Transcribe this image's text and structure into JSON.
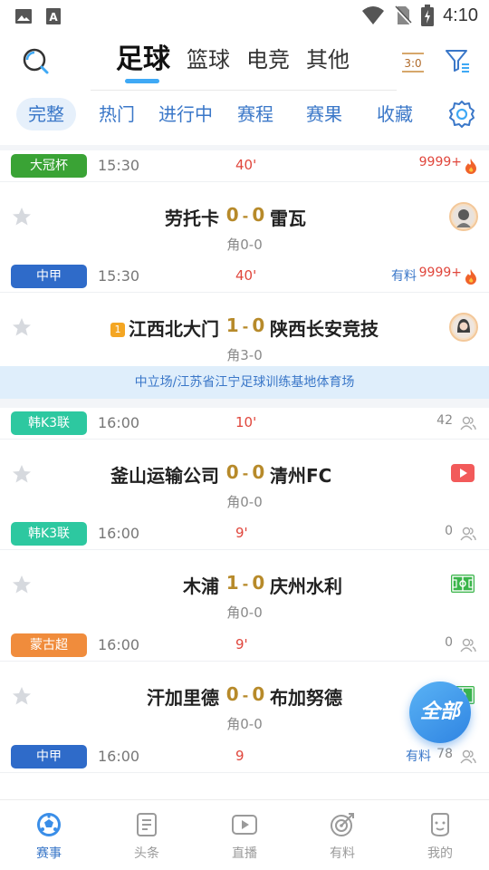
{
  "status_bar": {
    "time": "4:10"
  },
  "top_nav": {
    "sport_tabs": [
      "足球",
      "篮球",
      "电竞",
      "其他"
    ],
    "score_icon_text": "3:0"
  },
  "sub_tabs": [
    "完整",
    "热门",
    "进行中",
    "赛程",
    "赛果",
    "收藏"
  ],
  "matches": [
    {
      "league": "大冠杯",
      "league_color": "#3aa335",
      "time": "15:30",
      "minute": "40'",
      "info": "",
      "hot": "9999+",
      "count": "",
      "home": "劳托卡",
      "home_score": "0",
      "away_score": "0",
      "away": "雷瓦",
      "corner": "角0-0",
      "side": "avatar"
    },
    {
      "league": "中甲",
      "league_color": "#2f6bc9",
      "time": "15:30",
      "minute": "40'",
      "info": "有料",
      "hot": "9999+",
      "count": "",
      "home_rank": "1",
      "home": "江西北大门",
      "home_score": "1",
      "away_score": "0",
      "away": "陕西长安竞技",
      "corner": "角3-0",
      "side": "avatar",
      "venue": "中立场/江苏省江宁足球训练基地体育场"
    },
    {
      "league": "韩K3联",
      "league_color": "#2dc8a0",
      "time": "16:00",
      "minute": "10'",
      "info": "",
      "hot": "",
      "count": "42",
      "home": "釜山运输公司",
      "home_score": "0",
      "away_score": "0",
      "away": "清州FC",
      "corner": "角0-0",
      "side": "video"
    },
    {
      "league": "韩K3联",
      "league_color": "#2dc8a0",
      "time": "16:00",
      "minute": "9'",
      "info": "",
      "hot": "",
      "count": "0",
      "home": "木浦",
      "home_score": "1",
      "away_score": "0",
      "away": "庆州水利",
      "corner": "角0-0",
      "side": "field"
    },
    {
      "league": "蒙古超",
      "league_color": "#f08c3c",
      "time": "16:00",
      "minute": "9'",
      "info": "",
      "hot": "",
      "count": "0",
      "home": "汗加里德",
      "home_score": "0",
      "away_score": "0",
      "away": "布加努德",
      "corner": "角0-0",
      "side": "field"
    },
    {
      "league": "中甲",
      "league_color": "#2f6bc9",
      "time": "16:00",
      "minute": "9",
      "info": "有料",
      "hot": "",
      "count": "78"
    }
  ],
  "fab_label": "全部",
  "bottom_nav": [
    "赛事",
    "头条",
    "直播",
    "有料",
    "我的"
  ],
  "colors": {
    "accent": "#3a77c8",
    "live": "#e0463c",
    "score": "#b78a2a"
  }
}
